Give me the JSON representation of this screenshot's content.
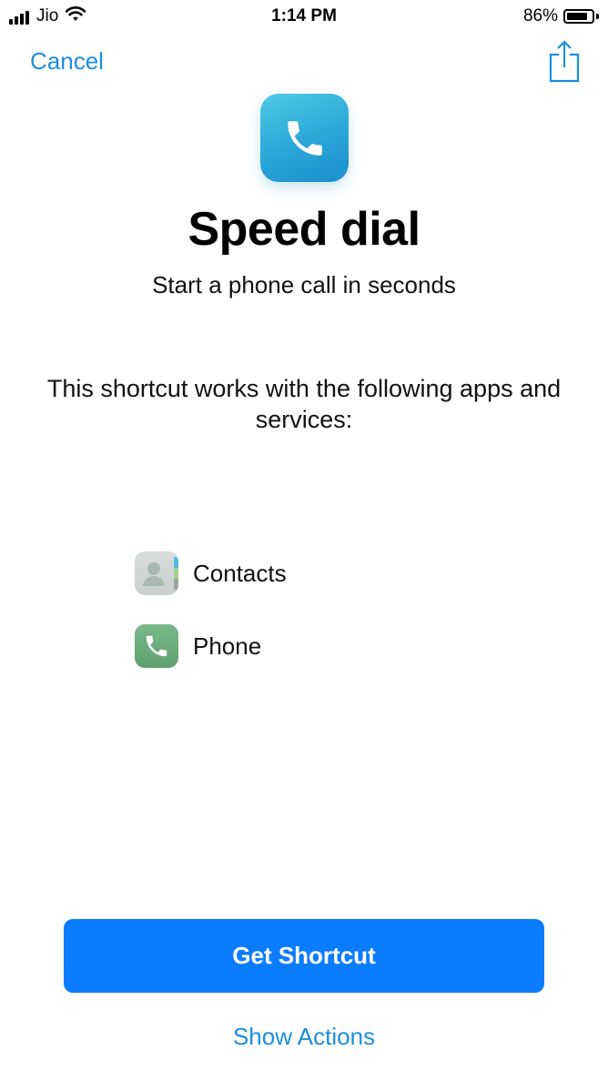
{
  "status_bar": {
    "carrier": "Jio",
    "time": "1:14 PM",
    "battery_percent": "86%",
    "battery_level": 0.86,
    "signal_bars": 4
  },
  "nav": {
    "cancel_label": "Cancel",
    "share_icon": "share-icon"
  },
  "header": {
    "icon": "phone-icon",
    "title": "Speed dial",
    "subtitle": "Start a phone call in seconds"
  },
  "works_with": {
    "text": "This shortcut works with the following apps and services:",
    "apps": [
      {
        "label": "Contacts",
        "icon": "contacts-icon"
      },
      {
        "label": "Phone",
        "icon": "phone-icon"
      }
    ]
  },
  "actions": {
    "get_shortcut_label": "Get Shortcut",
    "show_actions_label": "Show Actions"
  },
  "colors": {
    "accent": "#0a7cff",
    "link": "#1a8fe0"
  }
}
